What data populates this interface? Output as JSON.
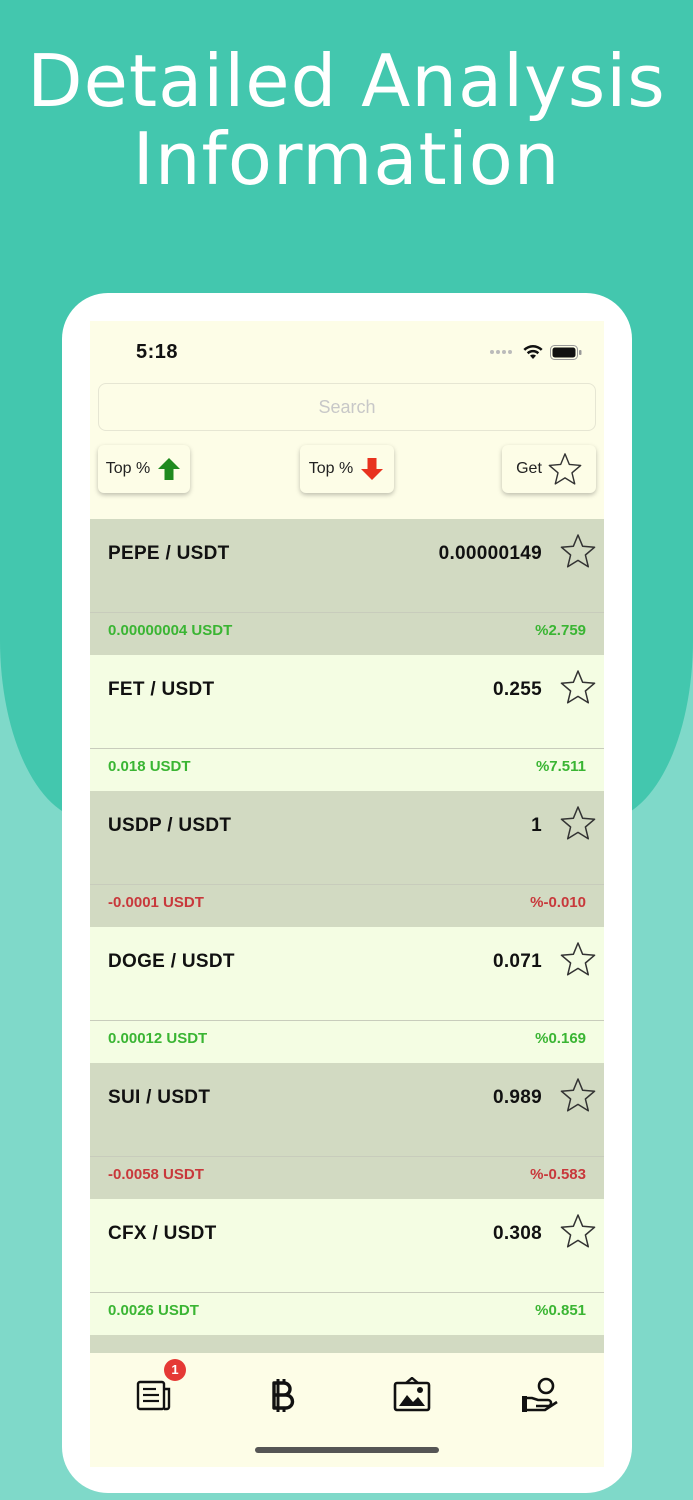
{
  "headline": {
    "line1": "Detailed Analysis",
    "line2": "Information"
  },
  "status_bar": {
    "time": "5:18"
  },
  "search": {
    "placeholder": "Search"
  },
  "filters": {
    "top_up_label": "Top %",
    "top_down_label": "Top %",
    "favorites_label": "Get"
  },
  "colors": {
    "positive": "#3ab533",
    "negative": "#c8383b",
    "row_dark": "#d2dac2",
    "row_light": "#f4fde3",
    "arrow_up": "#1f8a1f",
    "arrow_down": "#e8321e"
  },
  "coins": [
    {
      "pair": "PEPE / USDT",
      "price": "0.00000149",
      "change": "0.00000004 USDT",
      "percent": "%2.759",
      "trend": "pos"
    },
    {
      "pair": "FET / USDT",
      "price": "0.255",
      "change": "0.018 USDT",
      "percent": "%7.511",
      "trend": "pos"
    },
    {
      "pair": "USDP / USDT",
      "price": "1",
      "change": "-0.0001 USDT",
      "percent": "%-0.010",
      "trend": "neg"
    },
    {
      "pair": "DOGE / USDT",
      "price": "0.071",
      "change": "0.00012 USDT",
      "percent": "%0.169",
      "trend": "pos"
    },
    {
      "pair": "SUI / USDT",
      "price": "0.989",
      "change": "-0.0058 USDT",
      "percent": "%-0.583",
      "trend": "neg"
    },
    {
      "pair": "CFX / USDT",
      "price": "0.308",
      "change": "0.0026 USDT",
      "percent": "%0.851",
      "trend": "pos"
    }
  ],
  "tab_bar": {
    "news_badge": "1",
    "tabs": [
      "news-icon",
      "bitcoin-icon",
      "gallery-icon",
      "profile-icon"
    ]
  }
}
